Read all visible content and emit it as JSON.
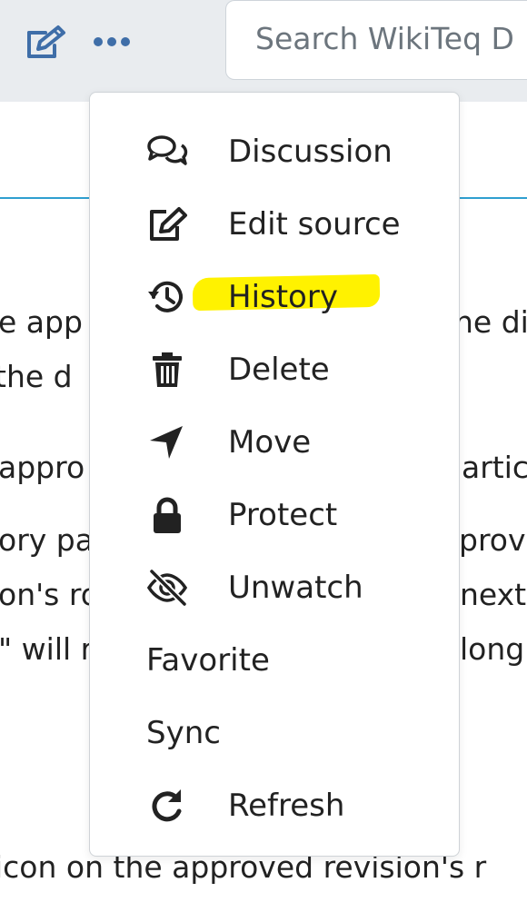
{
  "header": {
    "search_placeholder": "Search WikiTeq D"
  },
  "background_text": [
    "e app",
    "he dis",
    " the d",
    "appro",
    "artic",
    "ory pa",
    "prov",
    "on's ro",
    "next",
    "\" will r",
    "long",
    " icon on the approved revision's r"
  ],
  "menu": {
    "items": [
      {
        "label": "Discussion",
        "icon": "discussion-icon"
      },
      {
        "label": "Edit source",
        "icon": "edit-icon"
      },
      {
        "label": "History",
        "icon": "history-icon",
        "highlighted": true
      },
      {
        "label": "Delete",
        "icon": "trash-icon"
      },
      {
        "label": "Move",
        "icon": "move-icon"
      },
      {
        "label": "Protect",
        "icon": "lock-icon"
      },
      {
        "label": "Unwatch",
        "icon": "eye-slash-icon"
      },
      {
        "label": "Favorite",
        "icon": ""
      },
      {
        "label": "Sync",
        "icon": ""
      },
      {
        "label": "Refresh",
        "icon": "refresh-icon"
      }
    ]
  },
  "colors": {
    "accent_link": "#2f9fd0",
    "highlighter": "#fff200",
    "icon": "#222222",
    "edit_icon": "#36c"
  }
}
